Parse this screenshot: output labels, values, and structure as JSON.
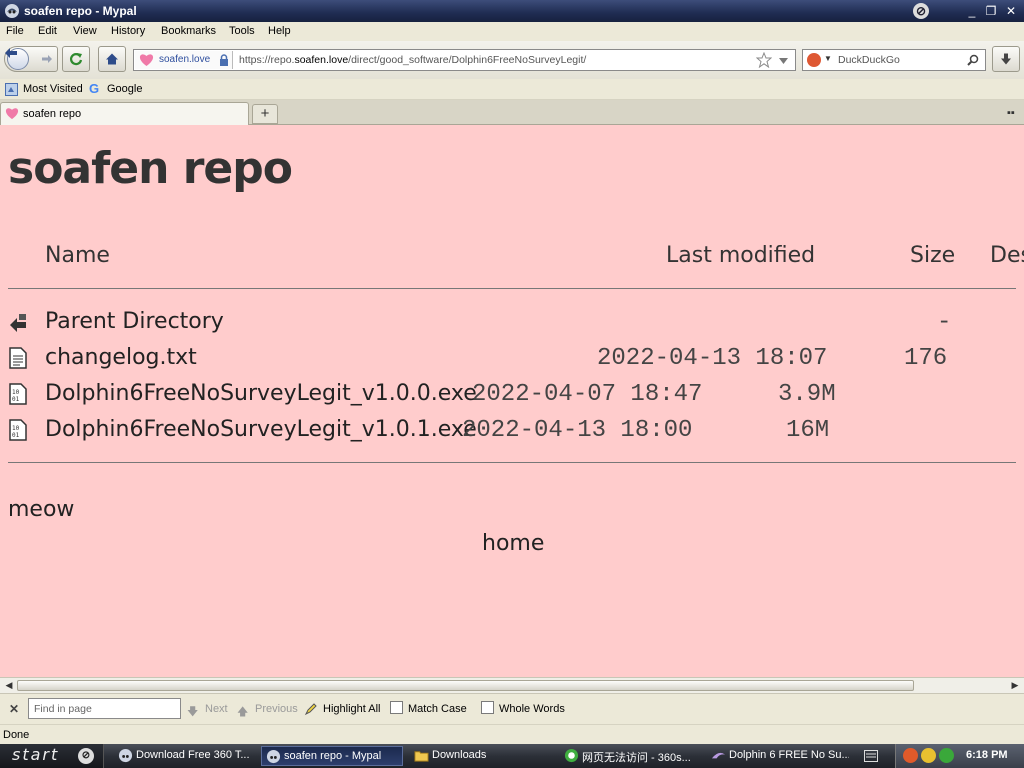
{
  "window": {
    "title": "soafen repo - Mypal"
  },
  "menu": [
    "File",
    "Edit",
    "View",
    "History",
    "Bookmarks",
    "Tools",
    "Help"
  ],
  "address": {
    "identity": "soafen.love",
    "url_prefix": "https://repo.",
    "url_domain": "soafen.love",
    "url_path": "/direct/good_software/Dolphin6FreeNoSurveyLegit/"
  },
  "search": {
    "engine": "DuckDuckGo"
  },
  "bookmarks": [
    "Most Visited",
    "Google"
  ],
  "tab": {
    "label": "soafen repo"
  },
  "page": {
    "title": "soafen repo",
    "headers": {
      "name": "Name",
      "modified": "Last modified",
      "size": "Size",
      "desc": "Des"
    },
    "rows": [
      {
        "name": "Parent Directory",
        "date": "",
        "size": "-",
        "icon": "back-folder-icon"
      },
      {
        "name": "changelog.txt",
        "date": "2022-04-13 18:07",
        "size": "176",
        "icon": "text-file-icon"
      },
      {
        "name": "Dolphin6FreeNoSurveyLegit_v1.0.0.exe",
        "date": "2022-04-07 18:47",
        "size": "3.9M",
        "icon": "binary-file-icon"
      },
      {
        "name": "Dolphin6FreeNoSurveyLegit_v1.0.1.exe",
        "date": "2022-04-13 18:00",
        "size": "16M",
        "icon": "binary-file-icon"
      }
    ],
    "footer": "meow",
    "home_link": "home"
  },
  "findbar": {
    "placeholder": "Find in page",
    "next": "Next",
    "previous": "Previous",
    "highlight_all": "Highlight All",
    "match_case": "Match Case",
    "whole_words": "Whole Words"
  },
  "status": "Done",
  "taskbar": {
    "start": "start",
    "tasks": [
      "Download Free 360 T...",
      "soafen repo - Mypal",
      "Downloads",
      "网页无法访问 - 360s...",
      "Dolphin 6 FREE No Su..."
    ],
    "clock": "6:18 PM"
  }
}
